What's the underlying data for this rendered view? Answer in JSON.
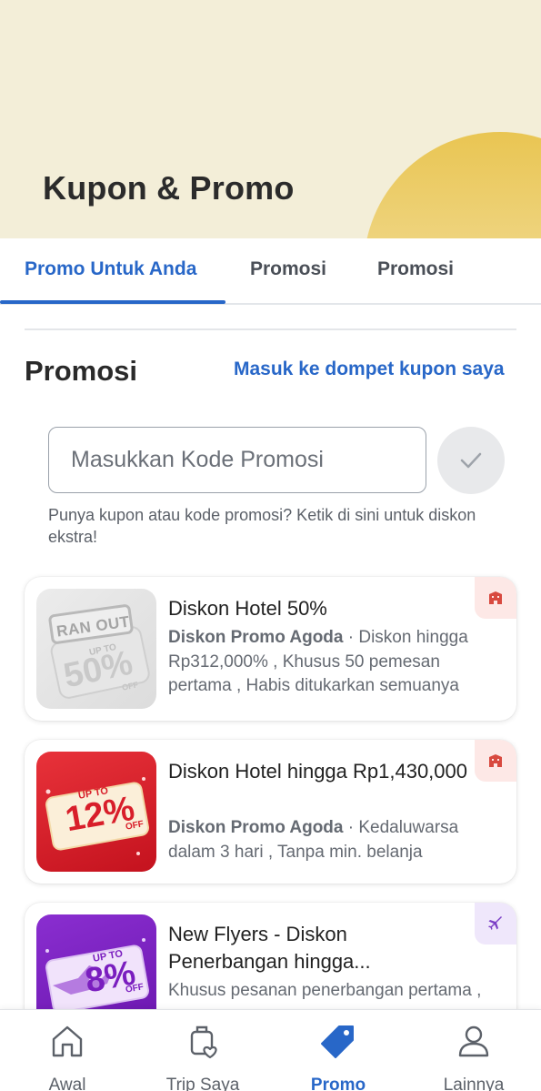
{
  "header": {
    "title": "Kupon & Promo"
  },
  "tabs": [
    {
      "label": "Promo Untuk Anda",
      "active": true
    },
    {
      "label": "Promosi",
      "active": false
    },
    {
      "label": "Promosi",
      "active": false
    }
  ],
  "promo": {
    "section_title": "Promosi",
    "wallet_link": "Masuk ke dompet kupon saya",
    "code_placeholder": "Masukkan Kode Promosi",
    "hint": "Punya kupon atau kode promosi? Ketik di sini untuk diskon ekstra!"
  },
  "cards": [
    {
      "title": "Diskon Hotel 50%",
      "source": "Diskon Promo Agoda",
      "details": " · Diskon hingga Rp312,000% , Khusus 50 pemesan pertama , Habis ditukarkan semuanya",
      "badge_icon": "hotel-icon",
      "thumb": {
        "stamp": "RAN OUT",
        "upto": "UP TO",
        "percent": "50%",
        "off": "OFF"
      }
    },
    {
      "title": "Diskon Hotel hingga Rp1,430,000",
      "source": "Diskon Promo Agoda",
      "details": " · Kedaluwarsa dalam 3 hari , Tanpa min. belanja",
      "badge_icon": "hotel-icon",
      "thumb": {
        "upto": "UP TO",
        "percent": "12%",
        "off": "OFF"
      }
    },
    {
      "title": "New Flyers - Diskon Penerbangan hingga...",
      "details": "Khusus pesanan penerbangan pertama ,",
      "badge_icon": "plane-icon",
      "thumb": {
        "upto": "UP TO",
        "percent": "8%",
        "off": "OFF"
      }
    }
  ],
  "bottom_nav": [
    {
      "label": "Awal",
      "icon": "home-icon",
      "active": false
    },
    {
      "label": "Trip Saya",
      "icon": "luggage-heart-icon",
      "active": false
    },
    {
      "label": "Promo",
      "icon": "tag-icon",
      "active": true
    },
    {
      "label": "Lainnya",
      "icon": "user-icon",
      "active": false
    }
  ],
  "colors": {
    "accent": "#2867c8",
    "header_bg": "#f3eed8",
    "hotel_badge": "#fde8e6",
    "flight_badge": "#efe7fb"
  }
}
